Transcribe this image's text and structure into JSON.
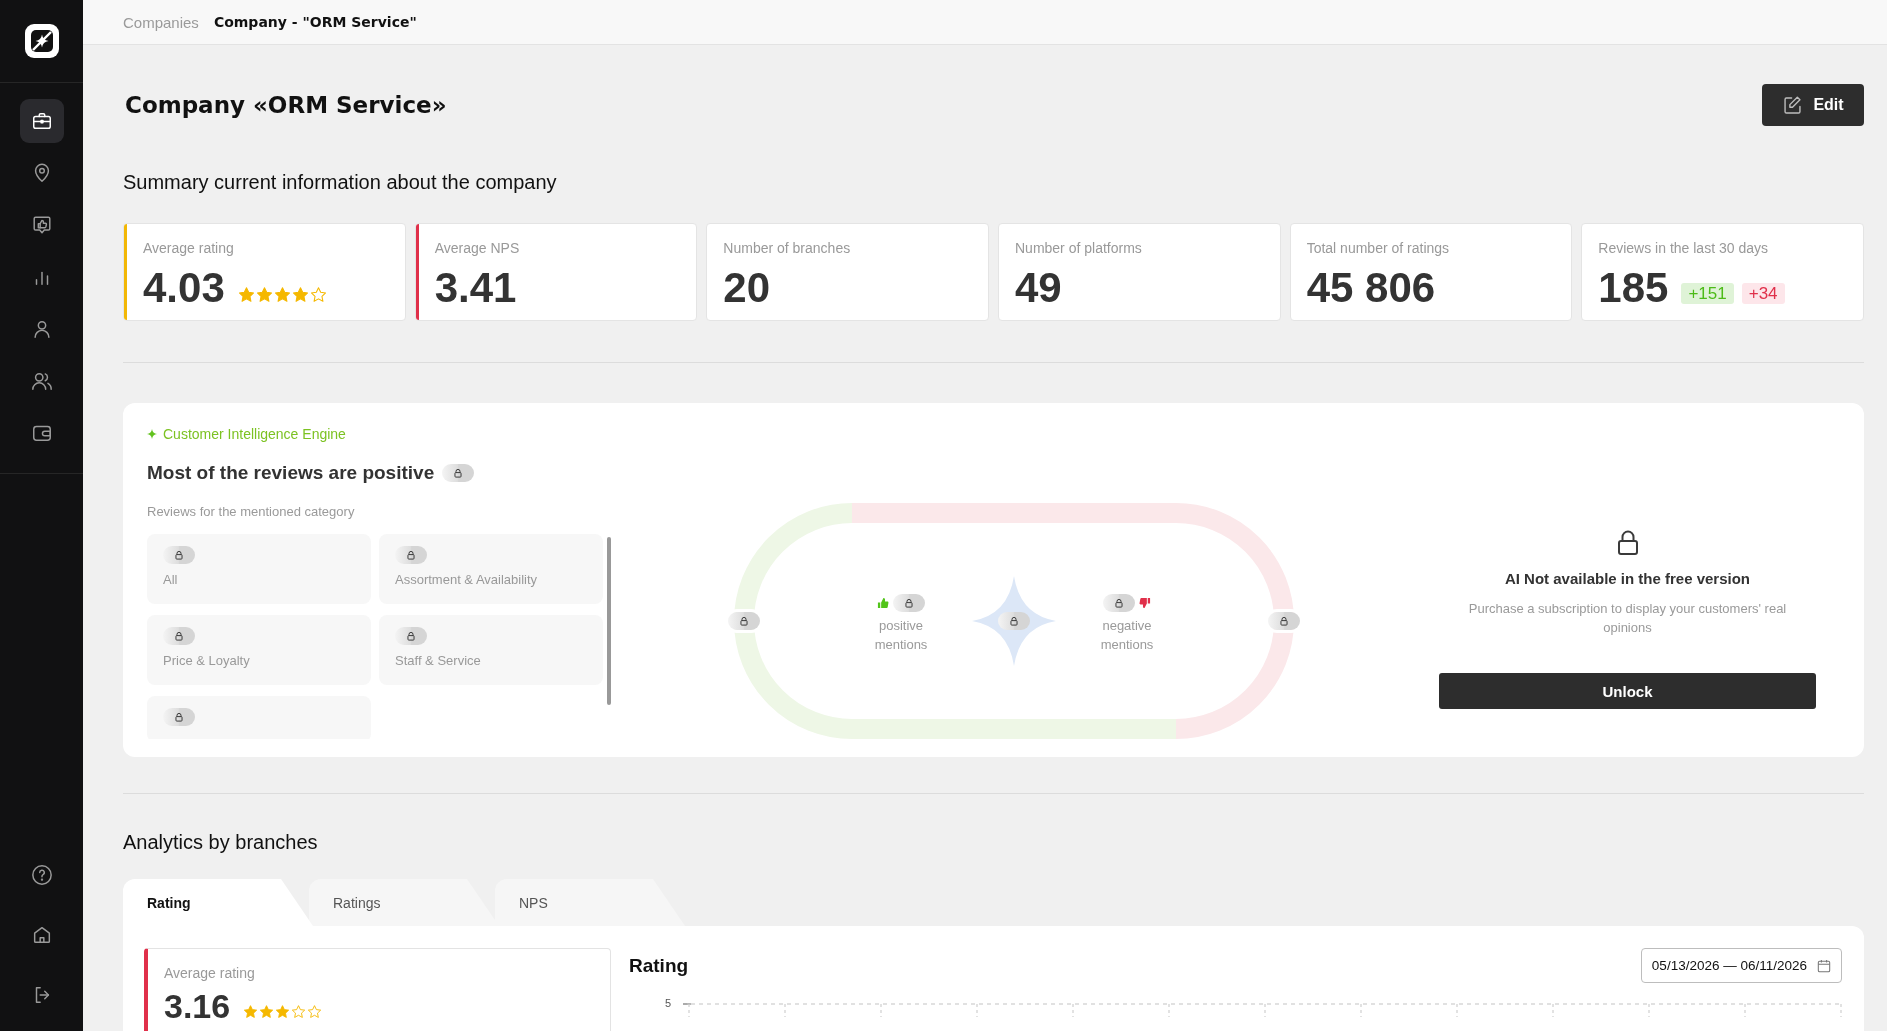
{
  "sidebar": {
    "nav_items": [
      {
        "selected": true
      },
      {
        "selected": false
      },
      {
        "selected": false
      },
      {
        "selected": false
      },
      {
        "selected": false
      },
      {
        "selected": false
      },
      {
        "selected": false
      }
    ]
  },
  "breadcrumbs": [
    {
      "label": "Companies",
      "current": false
    },
    {
      "label": "Company - \"ORM Service\"",
      "current": true
    }
  ],
  "header": {
    "title": "Company «ORM Service»",
    "edit_button": "Edit"
  },
  "summary": {
    "heading": "Summary current information about the company",
    "cards": [
      {
        "label": "Average rating",
        "value": "4.03",
        "stars": 4,
        "color": "#f2b705"
      },
      {
        "label": "Average NPS",
        "value": "3.41",
        "color": "#e0304a"
      },
      {
        "label": "Number of branches",
        "value": "20"
      },
      {
        "label": "Number of platforms",
        "value": "49"
      },
      {
        "label": "Total number of ratings",
        "value": "45 806"
      },
      {
        "label": "Reviews in the last 30 days",
        "value": "185",
        "badges": [
          {
            "text": "+151",
            "kind": "positive"
          },
          {
            "text": "+34",
            "kind": "negative"
          }
        ]
      }
    ]
  },
  "intelligence": {
    "label": "Customer Intelligence Engine",
    "heading": "Most of the reviews are positive",
    "locked": true,
    "subheading": "Reviews for the mentioned category",
    "categories": [
      {
        "label": "All",
        "locked": true
      },
      {
        "label": "Assortment & Availability",
        "locked": true
      },
      {
        "label": "Price & Loyalty",
        "locked": true
      },
      {
        "label": "Staff & Service",
        "locked": true
      },
      {
        "locked": true
      }
    ],
    "positive_label": "positive mentions",
    "negative_label": "negative mentions",
    "paywall": {
      "title": "AI Not available in the free version",
      "text": "Purchase a subscription to display your customers' real opinions",
      "button": "Unlock"
    }
  },
  "analytics": {
    "heading": "Analytics by branches",
    "tabs": [
      {
        "label": "Rating",
        "selected": true
      },
      {
        "label": "Ratings",
        "selected": false
      },
      {
        "label": "NPS",
        "selected": false
      }
    ],
    "average_card": {
      "label": "Average rating",
      "value": "3.16",
      "stars": 3
    },
    "chart_panel": {
      "title": "Rating",
      "date_range": "05/13/2026 — 06/11/2026",
      "y_tick_labels": [
        "5"
      ]
    }
  }
}
